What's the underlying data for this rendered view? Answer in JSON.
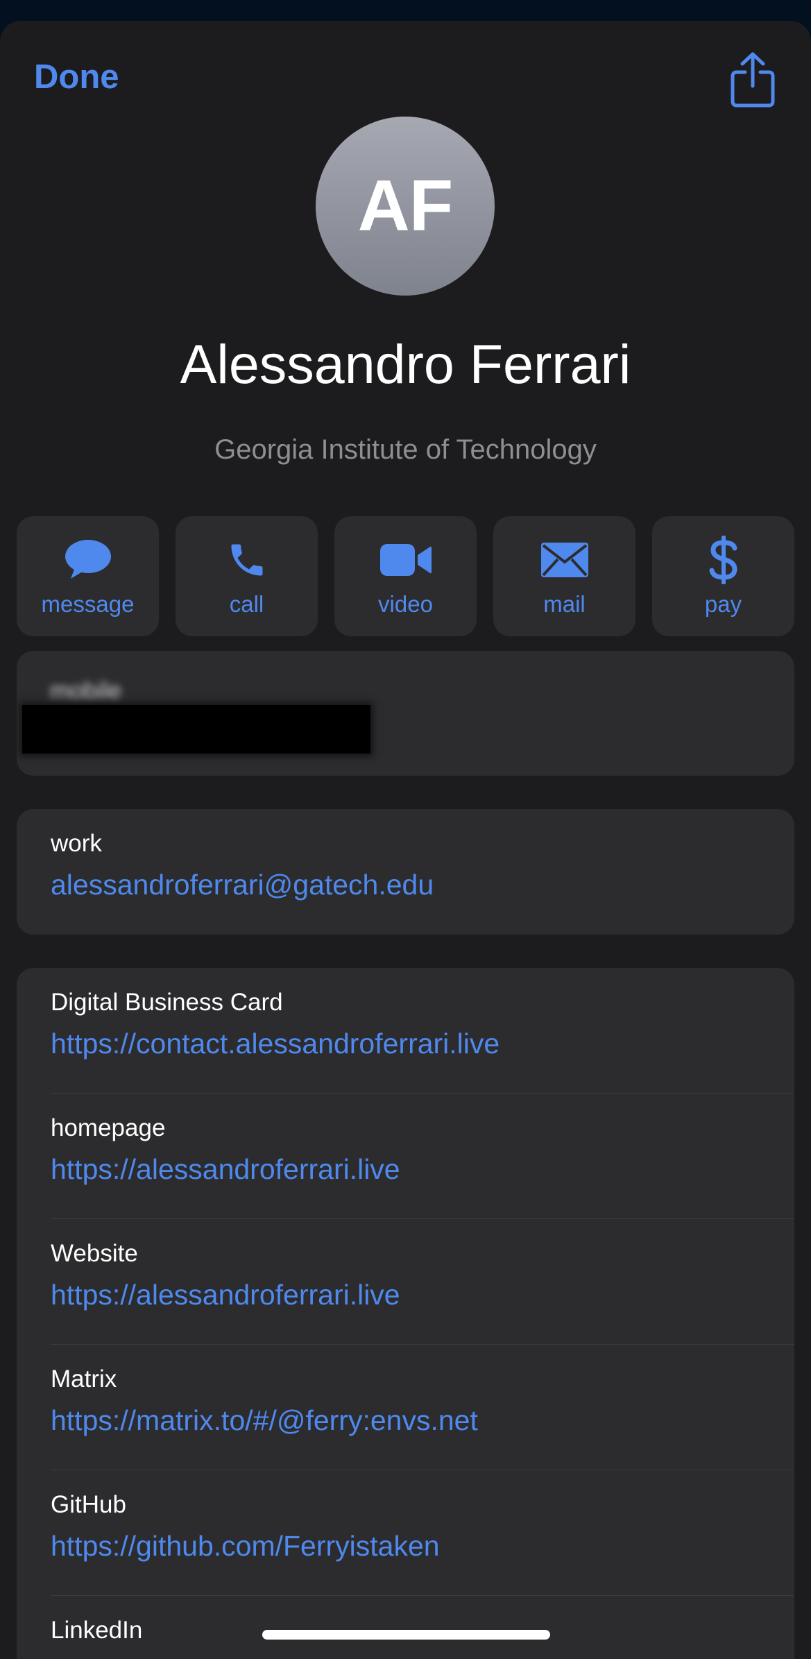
{
  "header": {
    "done_label": "Done",
    "share_icon": "share-icon"
  },
  "contact": {
    "initials": "AF",
    "name": "Alessandro Ferrari",
    "organization": "Georgia Institute of Technology"
  },
  "actions": [
    {
      "label": "message",
      "icon": "message-bubble-icon"
    },
    {
      "label": "call",
      "icon": "phone-icon"
    },
    {
      "label": "video",
      "icon": "video-camera-icon"
    },
    {
      "label": "mail",
      "icon": "envelope-icon"
    },
    {
      "label": "pay",
      "icon": "dollar-sign-icon"
    }
  ],
  "phone": {
    "label": "mobile"
  },
  "email": {
    "label": "work",
    "value": "alessandroferrari@gatech.edu"
  },
  "urls": [
    {
      "label": "Digital Business Card",
      "value": "https://contact.alessandroferrari.live"
    },
    {
      "label": "homepage",
      "value": "https://alessandroferrari.live"
    },
    {
      "label": "Website",
      "value": "https://alessandroferrari.live"
    },
    {
      "label": "Matrix",
      "value": "https://matrix.to/#/@ferry:envs.net"
    },
    {
      "label": "GitHub",
      "value": "https://github.com/Ferryistaken"
    },
    {
      "label": "LinkedIn",
      "value": ""
    }
  ],
  "colors": {
    "accent": "#4f89ee",
    "sheet_background": "#1c1c1e",
    "card_background": "#2c2c2e"
  }
}
